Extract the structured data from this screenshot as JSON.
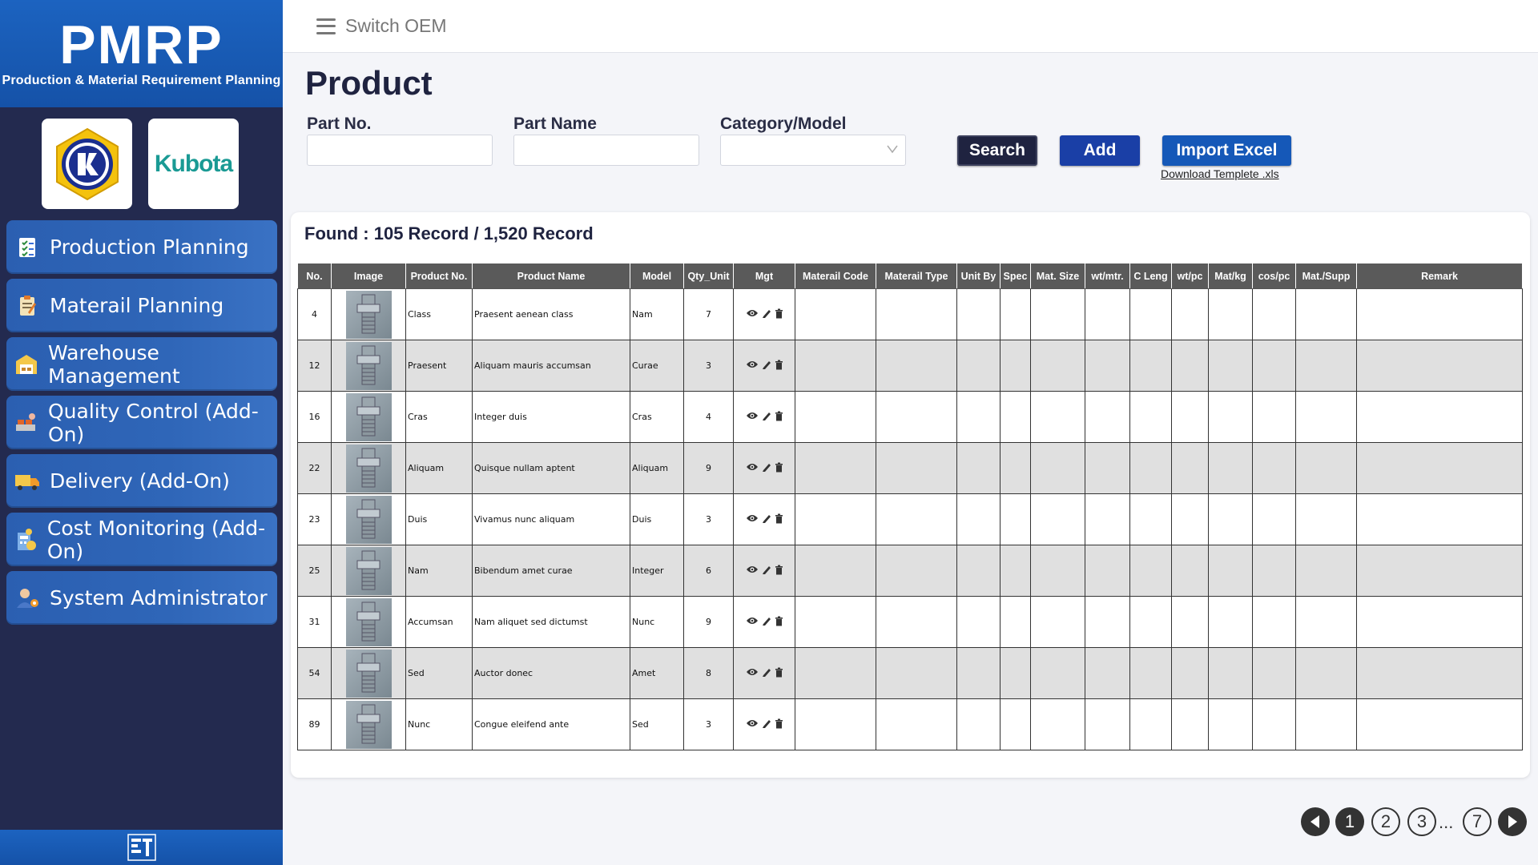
{
  "brand": {
    "title": "PMRP",
    "subtitle": "Production & Material Requirement Planning"
  },
  "logos": {
    "kubota": "Kubota"
  },
  "menu": [
    {
      "label": "Production Planning",
      "icon": "checklist-icon"
    },
    {
      "label": "Materail Planning",
      "icon": "clipboard-icon"
    },
    {
      "label": "Warehouse Management",
      "icon": "warehouse-icon"
    },
    {
      "label": "Quality Control (Add-On)",
      "icon": "quality-icon"
    },
    {
      "label": "Delivery (Add-On)",
      "icon": "truck-icon"
    },
    {
      "label": "Cost Monitoring (Add-On)",
      "icon": "cost-icon"
    },
    {
      "label": "System Administrator",
      "icon": "admin-icon"
    }
  ],
  "topbar": {
    "switch_label": "Switch OEM"
  },
  "page": {
    "title": "Product"
  },
  "filters": {
    "part_no_label": "Part No.",
    "part_name_label": "Part Name",
    "category_label": "Category/Model",
    "part_no_value": "",
    "part_name_value": "",
    "category_value": ""
  },
  "actions": {
    "search": "Search",
    "add": "Add",
    "import": "Import Excel",
    "download": "Download Templete .xls"
  },
  "summary": {
    "found": "Found : 105 Record / 1,520 Record"
  },
  "table": {
    "headers": [
      "No.",
      "Image",
      "Product No.",
      "Product Name",
      "Model",
      "Qty_Unit",
      "Mgt",
      "Materail Code",
      "Materail Type",
      "Unit By",
      "Spec",
      "Mat. Size",
      "wt/mtr.",
      "C Leng",
      "wt/pc",
      "Mat/kg",
      "cos/pc",
      "Mat./Supp",
      "Remark"
    ],
    "rows": [
      {
        "no": "4",
        "product_no": "Class",
        "product_name": "Praesent aenean class",
        "model": "Nam",
        "qty": "7"
      },
      {
        "no": "12",
        "product_no": "Praesent",
        "product_name": "Aliquam mauris accumsan",
        "model": "Curae",
        "qty": "3"
      },
      {
        "no": "16",
        "product_no": "Cras",
        "product_name": "Integer duis",
        "model": "Cras",
        "qty": "4"
      },
      {
        "no": "22",
        "product_no": "Aliquam",
        "product_name": "Quisque nullam aptent",
        "model": "Aliquam",
        "qty": "9"
      },
      {
        "no": "23",
        "product_no": "Duis",
        "product_name": "Vivamus nunc aliquam",
        "model": "Duis",
        "qty": "3"
      },
      {
        "no": "25",
        "product_no": "Nam",
        "product_name": "Bibendum amet curae",
        "model": "Integer",
        "qty": "6"
      },
      {
        "no": "31",
        "product_no": "Accumsan",
        "product_name": "Nam aliquet sed dictumst",
        "model": "Nunc",
        "qty": "9"
      },
      {
        "no": "54",
        "product_no": "Sed",
        "product_name": "Auctor donec",
        "model": "Amet",
        "qty": "8"
      },
      {
        "no": "89",
        "product_no": "Nunc",
        "product_name": "Congue eleifend ante",
        "model": "Sed",
        "qty": "3"
      }
    ]
  },
  "pagination": {
    "pages": [
      "1",
      "2",
      "3",
      "7"
    ],
    "current": "1",
    "ellipsis": "..."
  },
  "colors": {
    "sidebar_bg": "#232a4f",
    "brand_blue": "#1552a8",
    "menu_blue": "#2f66b8",
    "header_gray": "#5a5a5a",
    "dark_button": "#1f2340",
    "add_button": "#1a3fa6",
    "import_button": "#1558b8"
  }
}
